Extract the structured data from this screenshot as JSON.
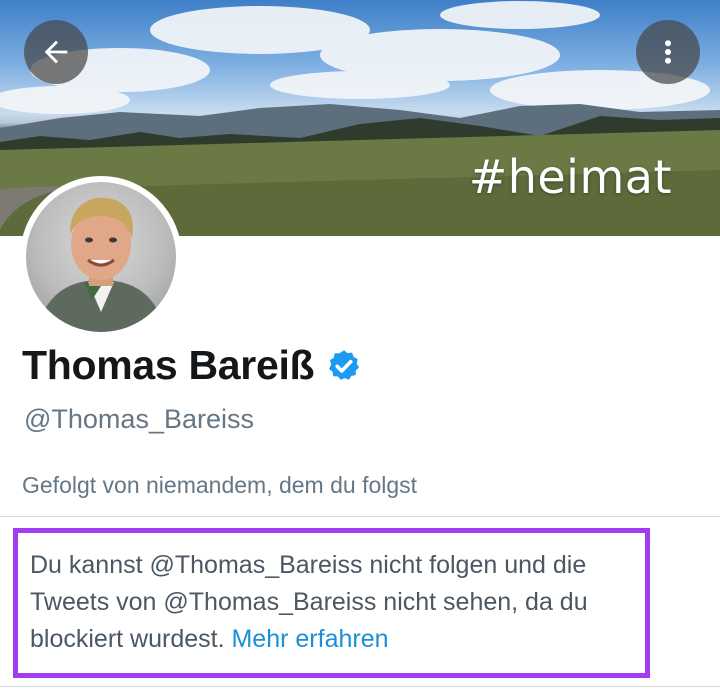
{
  "header": {
    "banner_hashtag": "#heimat",
    "back_icon": "arrow-left-icon",
    "more_icon": "vertical-dots-icon"
  },
  "profile": {
    "display_name": "Thomas Bareiß",
    "verified": true,
    "handle": "@Thomas_Bareiss",
    "followed_by_text": "Gefolgt von niemandem, dem du folgst"
  },
  "blocked_notice": {
    "message": "Du kannst @Thomas_Bareiss nicht folgen und die Tweets von @Thomas_Bareiss nicht sehen, da du blockiert wurdest.",
    "link_label": "Mehr erfahren"
  },
  "colors": {
    "verified_badge": "#1d9bf0",
    "link": "#1b8fd6",
    "highlight_border": "#a23cf0",
    "secondary_text": "#657786"
  }
}
